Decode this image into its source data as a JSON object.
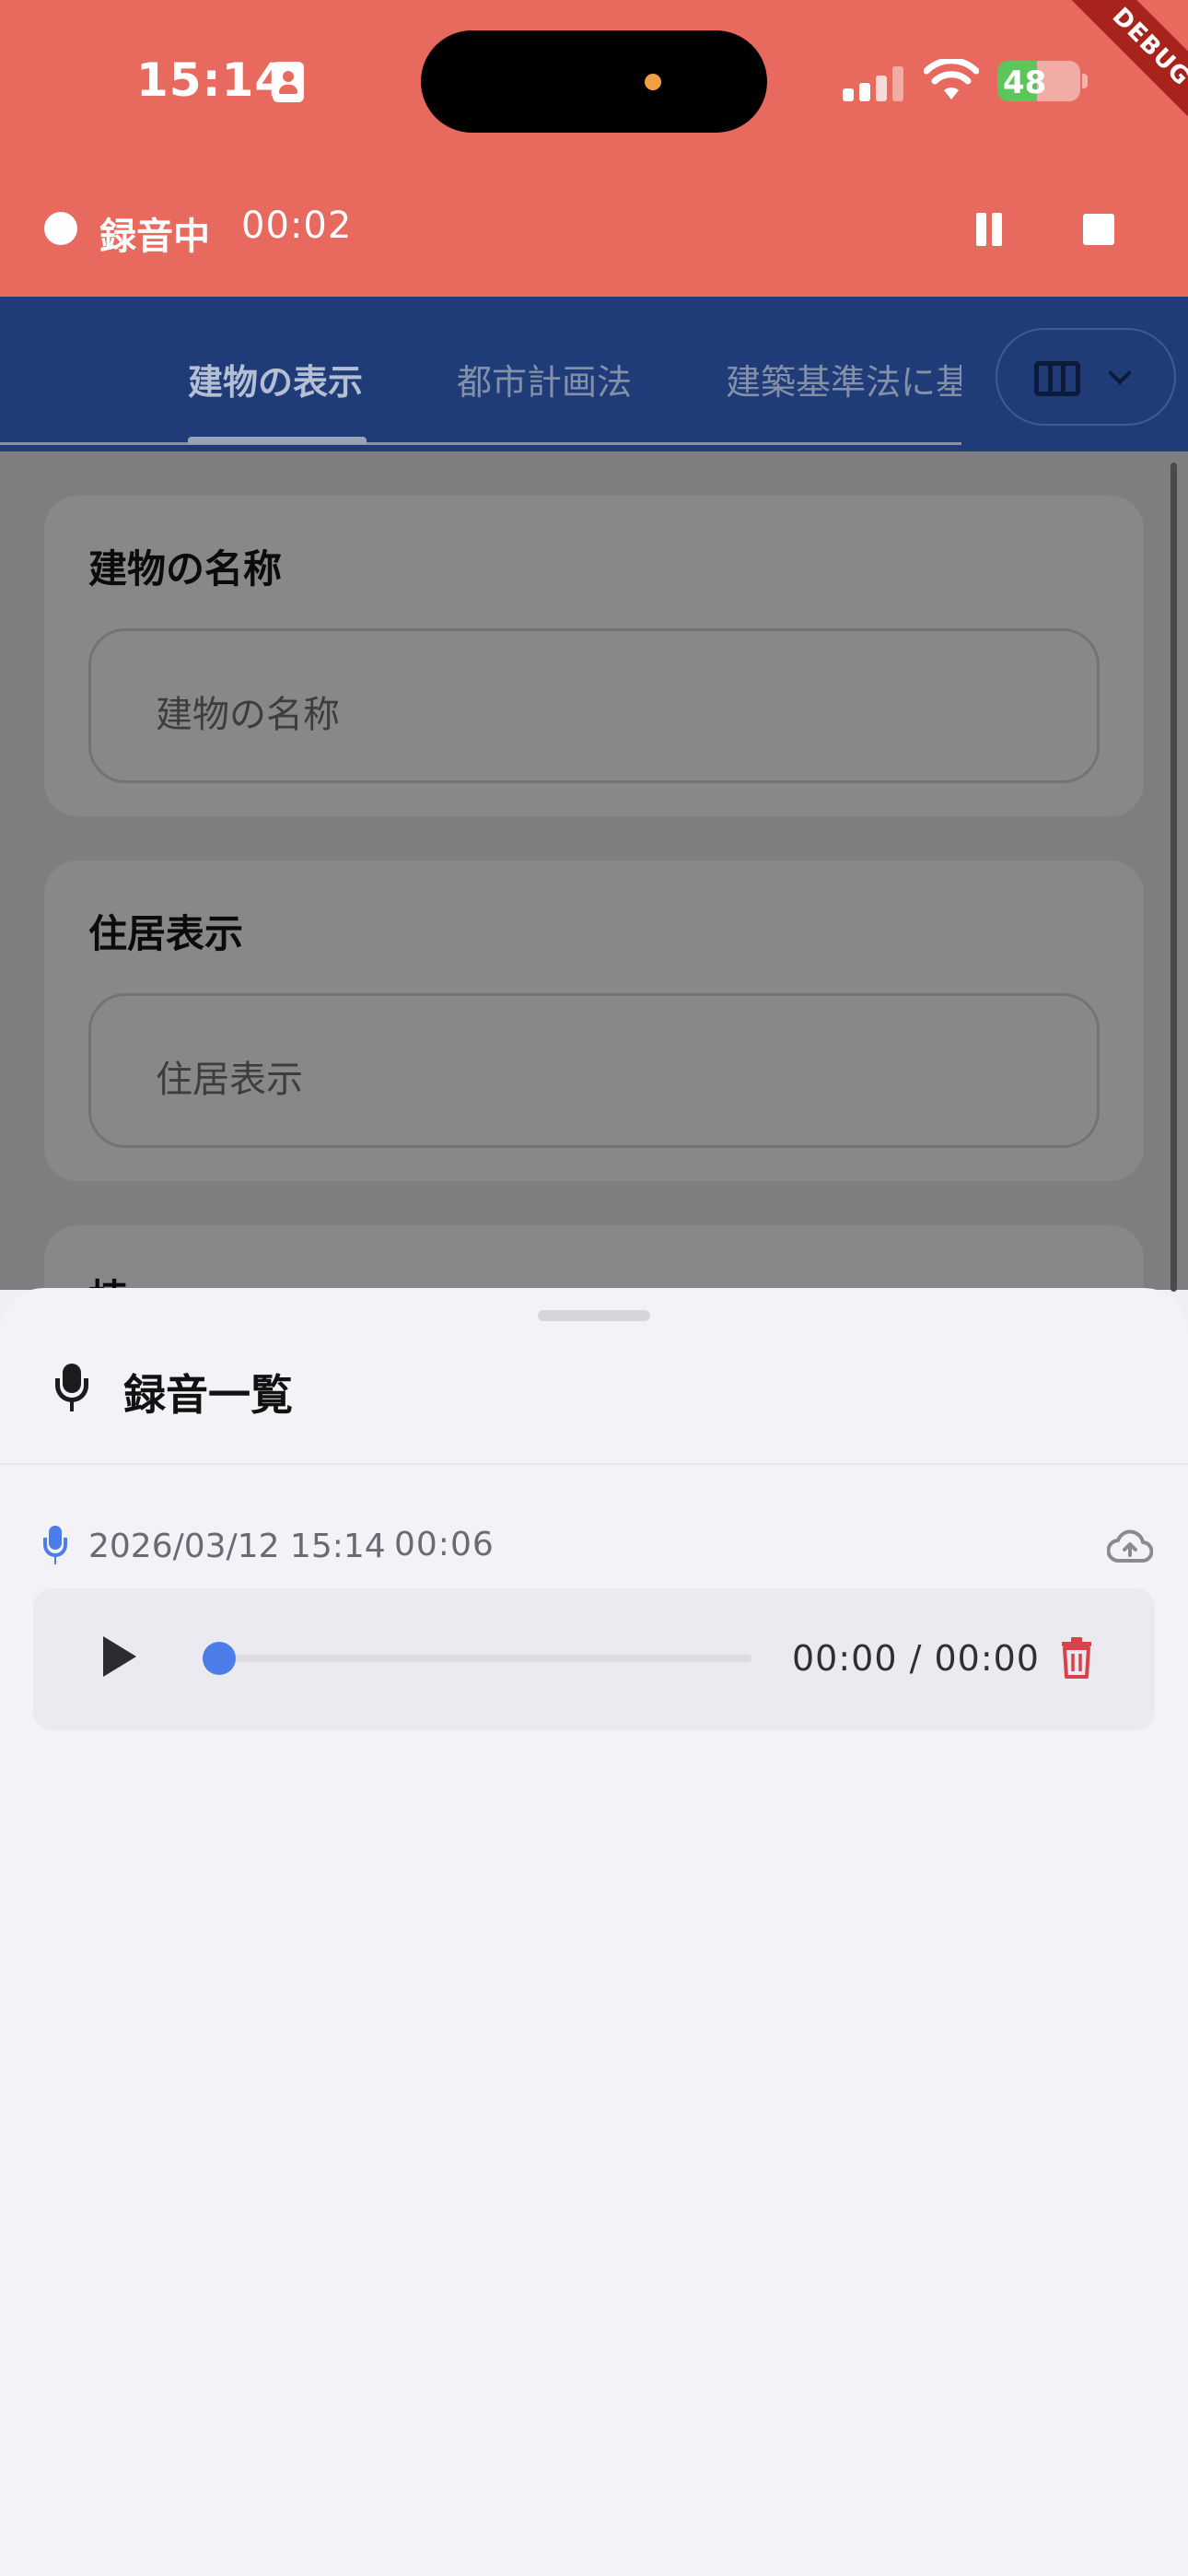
{
  "status_bar": {
    "time": "15:14",
    "battery_level": "48",
    "battery_percent": 48
  },
  "debug_banner": "DEBUG",
  "recording_bar": {
    "label": "録音中",
    "elapsed": "00:02"
  },
  "tabs": [
    {
      "label": "建物の表示",
      "active": true
    },
    {
      "label": "都市計画法",
      "active": false
    },
    {
      "label": "建築基準法に基",
      "active": false
    }
  ],
  "form": {
    "fields": [
      {
        "title": "建物の名称",
        "placeholder": "建物の名称"
      },
      {
        "title": "住居表示",
        "placeholder": "住居表示"
      },
      {
        "title": "棟"
      }
    ]
  },
  "sheet": {
    "title": "録音一覧",
    "recordings": [
      {
        "date": "2026/03/12 15:14",
        "duration": "00:06",
        "playback": "00:00 / 00:00",
        "progress": 0
      }
    ]
  },
  "colors": {
    "recording_bar": "#e8695d",
    "app_bar": "#203c78",
    "accent": "#4c7de8",
    "delete": "#d9424a"
  }
}
